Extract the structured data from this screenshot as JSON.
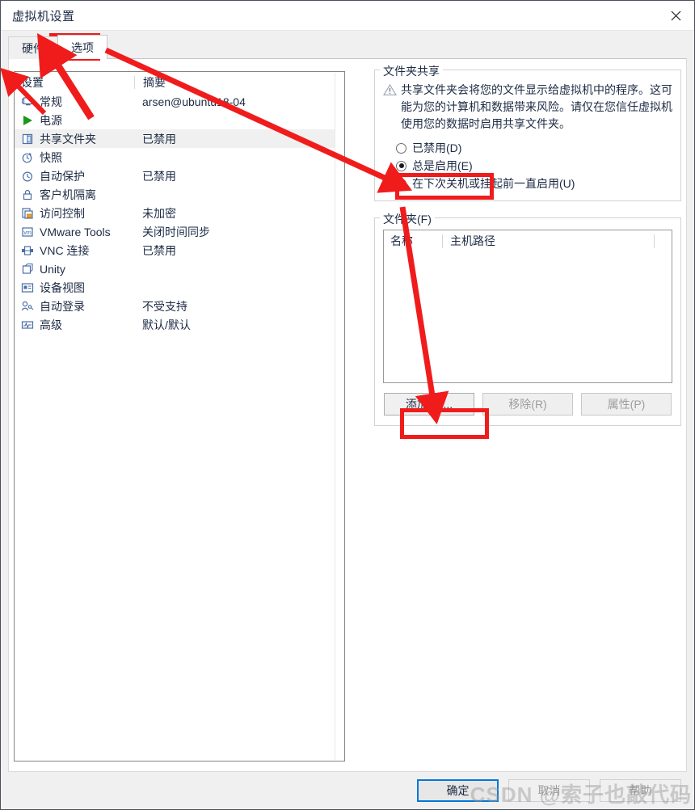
{
  "window": {
    "title": "虚拟机设置",
    "close_icon": "close-icon"
  },
  "tabs": [
    {
      "label": "硬件",
      "active": false
    },
    {
      "label": "选项",
      "active": true
    }
  ],
  "settings_list": {
    "columns": [
      "设置",
      "摘要"
    ],
    "rows": [
      {
        "icon": "monitor-icon",
        "name": "常规",
        "summary": "arsen@ubuntu18-04",
        "selected": false
      },
      {
        "icon": "play-icon",
        "name": "电源",
        "summary": "",
        "selected": false
      },
      {
        "icon": "shared-folder-icon",
        "name": "共享文件夹",
        "summary": "已禁用",
        "selected": true
      },
      {
        "icon": "snapshot-icon",
        "name": "快照",
        "summary": "",
        "selected": false
      },
      {
        "icon": "autoprotect-icon",
        "name": "自动保护",
        "summary": "已禁用",
        "selected": false
      },
      {
        "icon": "lock-icon",
        "name": "客户机隔离",
        "summary": "",
        "selected": false
      },
      {
        "icon": "access-control-icon",
        "name": "访问控制",
        "summary": "未加密",
        "selected": false
      },
      {
        "icon": "vmware-tools-icon",
        "name": "VMware Tools",
        "summary": "关闭时间同步",
        "selected": false
      },
      {
        "icon": "vnc-icon",
        "name": "VNC 连接",
        "summary": "已禁用",
        "selected": false
      },
      {
        "icon": "unity-icon",
        "name": "Unity",
        "summary": "",
        "selected": false
      },
      {
        "icon": "device-view-icon",
        "name": "设备视图",
        "summary": "",
        "selected": false
      },
      {
        "icon": "autologon-icon",
        "name": "自动登录",
        "summary": "不受支持",
        "selected": false
      },
      {
        "icon": "advanced-icon",
        "name": "高级",
        "summary": "默认/默认",
        "selected": false
      }
    ]
  },
  "folder_sharing": {
    "group_title": "文件夹共享",
    "warning_icon": "warning-triangle-icon",
    "warning_text": "共享文件夹会将您的文件显示给虚拟机中的程序。这可能为您的计算机和数据带来风险。请仅在您信任虚拟机使用您的数据时启用共享文件夹。",
    "options": [
      {
        "label": "已禁用(D)",
        "checked": false
      },
      {
        "label": "总是启用(E)",
        "checked": true
      },
      {
        "label": "在下次关机或挂起前一直启用(U)",
        "checked": false
      }
    ]
  },
  "folders": {
    "group_title": "文件夹(F)",
    "columns": [
      "名称",
      "主机路径",
      ""
    ],
    "rows": [],
    "buttons": [
      {
        "label": "添加(A)...",
        "enabled": true
      },
      {
        "label": "移除(R)",
        "enabled": false
      },
      {
        "label": "属性(P)",
        "enabled": false
      }
    ]
  },
  "footer": {
    "buttons": [
      {
        "label": "确定",
        "style": "primary"
      },
      {
        "label": "取消",
        "style": "disabled"
      },
      {
        "label": "帮助",
        "style": "disabled"
      }
    ]
  },
  "annotations": {
    "highlight_color": "#f01c1c",
    "highlights": [
      {
        "name": "options-tab-highlight"
      },
      {
        "name": "always-enabled-radio-highlight"
      },
      {
        "name": "add-button-highlight"
      }
    ],
    "arrows": [
      {
        "name": "arrow-to-options-tab"
      },
      {
        "name": "arrow-to-always-enabled-radio"
      },
      {
        "name": "arrow-to-add-button"
      },
      {
        "name": "arrow-to-settings-list"
      }
    ]
  },
  "watermark": {
    "text": "CSDN @索子也敲代码"
  }
}
